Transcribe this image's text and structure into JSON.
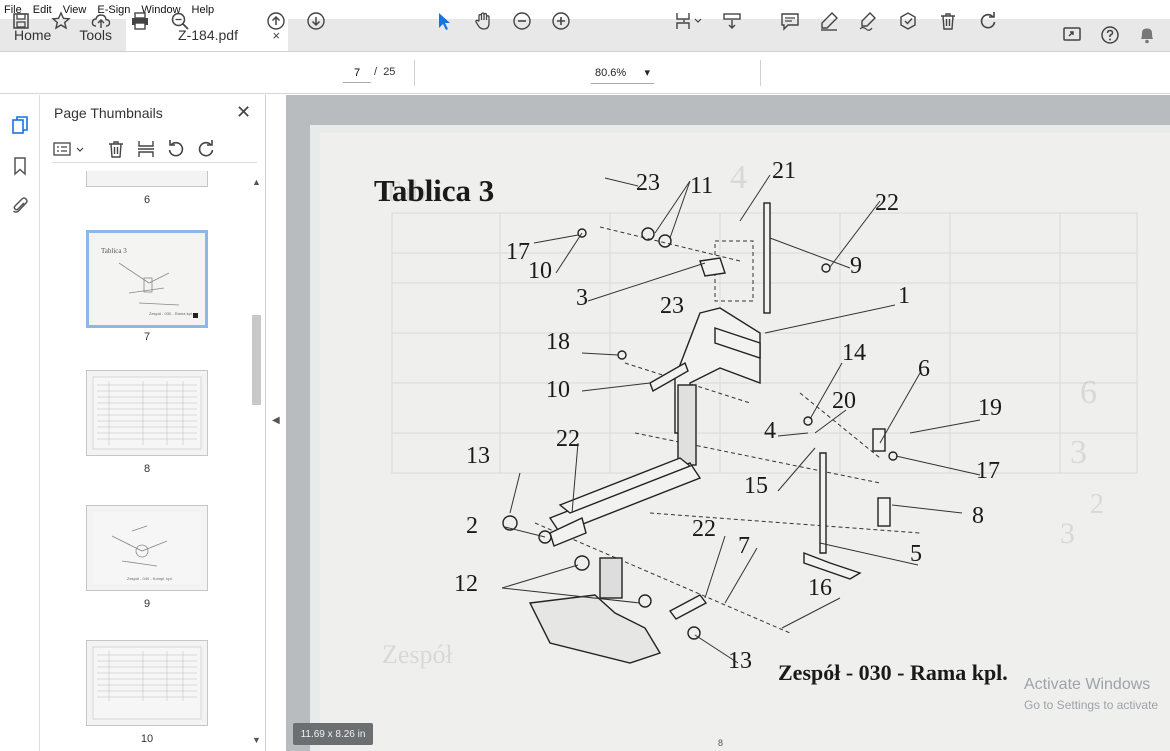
{
  "menubar": {
    "items": [
      "File",
      "Edit",
      "View",
      "E-Sign",
      "Window",
      "Help"
    ]
  },
  "tabs": {
    "home": "Home",
    "tools": "Tools",
    "document": "Z-184.pdf",
    "close": "×"
  },
  "toolbar": {
    "current_page": "7",
    "page_separator": "/",
    "total_pages": "25",
    "zoom": "80.6%"
  },
  "sidebar": {
    "title": "Page Thumbnails",
    "close": "✕",
    "thumbnails": [
      {
        "label": "6"
      },
      {
        "label": "7",
        "selected": true
      },
      {
        "label": "8"
      },
      {
        "label": "9"
      },
      {
        "label": "10"
      }
    ]
  },
  "document": {
    "title": "Tablica 3",
    "caption": "Zespół -  030 -  Rama kpl.",
    "page_number": "8",
    "callouts": [
      "23",
      "11",
      "21",
      "22",
      "17",
      "10",
      "9",
      "3",
      "23",
      "1",
      "18",
      "14",
      "10",
      "20",
      "6",
      "19",
      "4",
      "22",
      "13",
      "17",
      "15",
      "8",
      "2",
      "22",
      "7",
      "5",
      "12",
      "16",
      "13"
    ],
    "ghost_title": "Tablica 3",
    "ghost_caption": "Zespół",
    "ghost_numbers": [
      "4",
      "6",
      "3",
      "2",
      "3"
    ]
  },
  "status": {
    "dimensions": "11.69 x 8.26 in"
  },
  "watermark": {
    "line1": "Activate Windows",
    "line2": "Go to Settings to activate"
  },
  "colors": {
    "accent": "#1473e6",
    "selection": "#8db7e6"
  }
}
